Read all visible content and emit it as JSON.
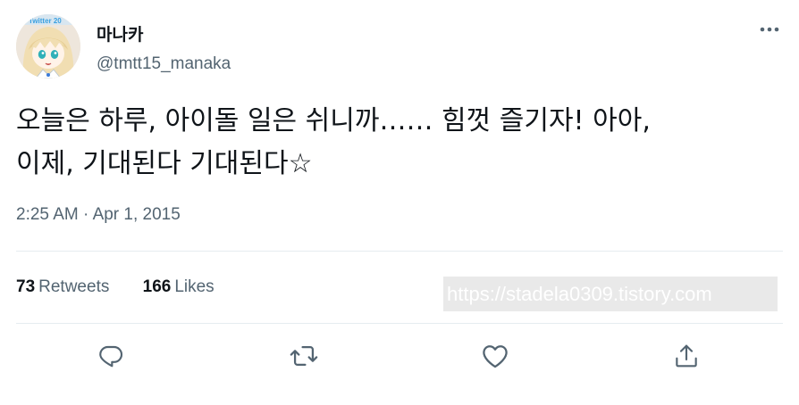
{
  "author": {
    "display_name": "마나카",
    "handle": "@tmtt15_manaka",
    "avatar_label": "Twitter 20"
  },
  "tweet": {
    "text": "오늘은 하루, 아이돌 일은 쉬니까…… 힘껏 즐기자! 아아,\n이제, 기대된다 기대된다☆",
    "time": "2:25 AM",
    "separator": "·",
    "date": "Apr 1, 2015"
  },
  "stats": {
    "retweets_count": "73",
    "retweets_label": "Retweets",
    "likes_count": "166",
    "likes_label": "Likes"
  },
  "watermark": "https://stadela0309.tistory.com",
  "icons": {
    "more": "more-dots-icon",
    "reply": "reply-icon",
    "retweet": "retweet-icon",
    "like": "heart-icon",
    "share": "share-icon"
  },
  "colors": {
    "text": "#0f1419",
    "secondary": "#536471",
    "divider": "#e6ecf0"
  }
}
